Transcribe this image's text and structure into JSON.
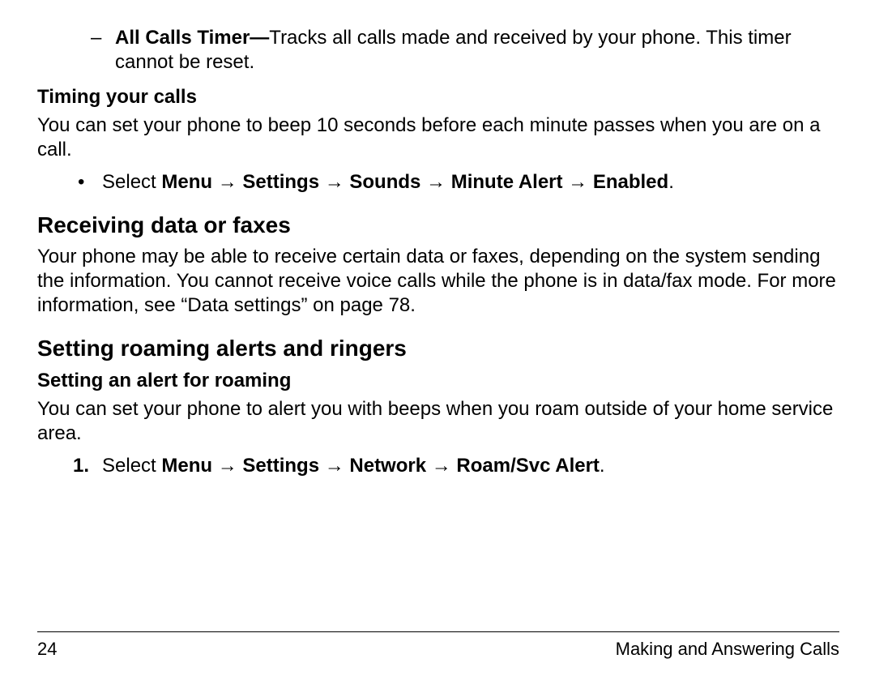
{
  "intro_item": {
    "bold_lead": "All Calls Timer—",
    "rest": "Tracks all calls made and received by your phone. This timer cannot be reset."
  },
  "timing": {
    "heading": "Timing your calls",
    "para": "You can set your phone to beep 10 seconds before each minute passes when you are on a call.",
    "bullet_prefix": "Select ",
    "bullet_bold": "Menu → Settings → Sounds → Minute Alert → Enabled",
    "bullet_suffix": "."
  },
  "receiving": {
    "heading": "Receiving data or faxes",
    "para": "Your phone may be able to receive certain data or faxes, depending on the system sending the information. You cannot receive voice calls while the phone is in data/fax mode. For more information, see “Data settings” on page 78."
  },
  "roaming": {
    "heading": "Setting roaming alerts and ringers",
    "sub_heading": "Setting an alert for roaming",
    "para": "You can set your phone to alert you with beeps when you roam outside of your home service area.",
    "step_num": "1.",
    "step_prefix": "Select ",
    "step_bold": "Menu → Settings → Network → Roam/Svc Alert",
    "step_suffix": "."
  },
  "footer": {
    "page_number": "24",
    "chapter": "Making and Answering Calls"
  }
}
